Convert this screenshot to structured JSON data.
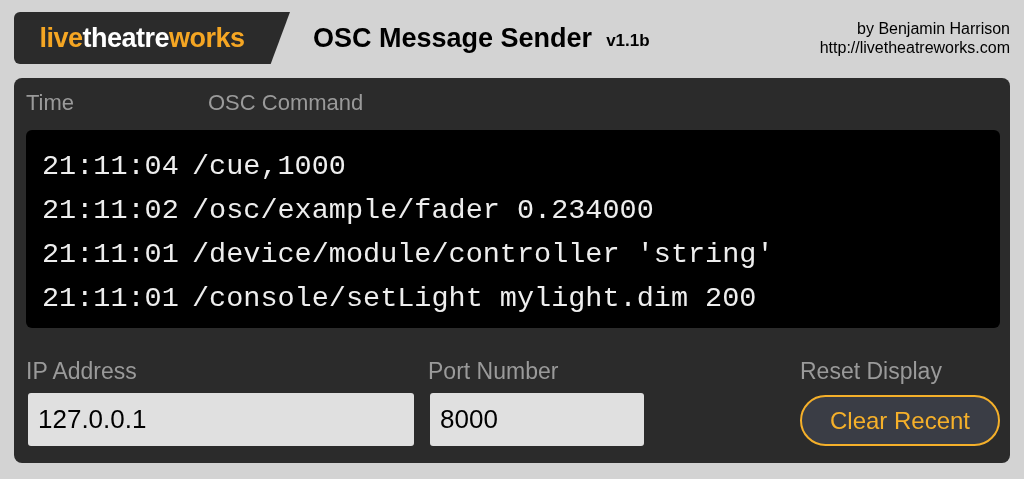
{
  "header": {
    "logo": [
      {
        "text": "live",
        "color": "#f5a623"
      },
      {
        "text": "theatre",
        "color": "#ffffff"
      },
      {
        "text": "works",
        "color": "#f5a623"
      }
    ],
    "title": "OSC Message Sender",
    "version": "v1.1b",
    "author": "by Benjamin Harrison",
    "url": "http://livetheatreworks.com"
  },
  "log": {
    "columns": [
      "Time",
      "OSC Command"
    ],
    "rows": [
      {
        "time": "21:11:04",
        "command": "/cue,1000"
      },
      {
        "time": "21:11:02",
        "command": "/osc/example/fader 0.234000"
      },
      {
        "time": "21:11:01",
        "command": "/device/module/controller 'string'"
      },
      {
        "time": "21:11:01",
        "command": "/console/setLight mylight.dim 200"
      }
    ]
  },
  "fields": [
    {
      "label": "IP Address",
      "value": "127.0.0.1"
    },
    {
      "label": "Port Number",
      "value": "8000"
    }
  ],
  "reset": {
    "label": "Reset Display",
    "button": "Clear Recent"
  }
}
